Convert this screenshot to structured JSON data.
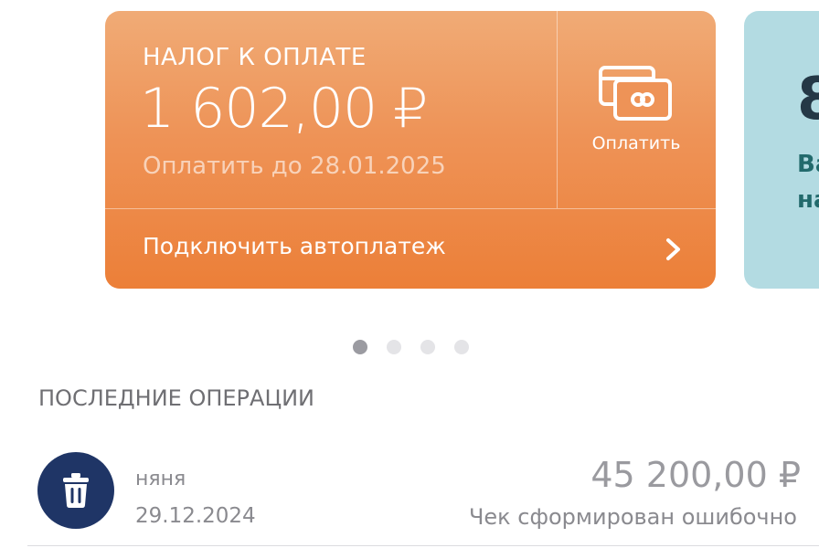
{
  "tax_card": {
    "title": "НАЛОГ К ОПЛАТЕ",
    "amount": "1 602,00 ₽",
    "due_text": "Оплатить до 28.01.2025",
    "pay_label": "Оплатить",
    "pay_icon": "credit-cards-icon",
    "autopay_label": "Подключить автоплатеж",
    "autopay_icon": "chevron-right-icon"
  },
  "info_card": {
    "big_text": "8",
    "line1": "Ва",
    "line2": "на"
  },
  "pagination": {
    "total": 4,
    "active_index": 0
  },
  "operations": {
    "title": "ПОСЛЕДНИЕ ОПЕРАЦИИ",
    "items": [
      {
        "name": "няня",
        "date": "29.12.2024",
        "amount": "45 200,00 ₽",
        "status": "Чек сформирован ошибочно",
        "icon": "trash-icon"
      }
    ]
  },
  "colors": {
    "tax_card_top": "#f0ab76",
    "tax_card_bottom": "#ec7f38",
    "info_card_bg": "#b3dbe2",
    "avatar_bg": "#1f3566"
  }
}
